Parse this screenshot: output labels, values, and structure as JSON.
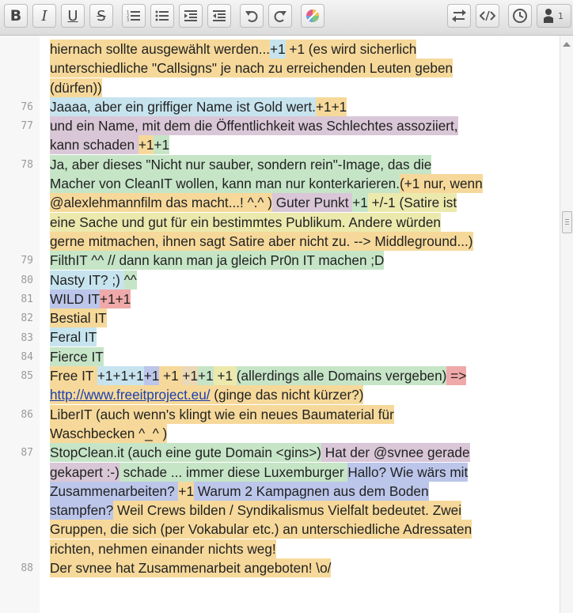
{
  "toolbar": {
    "bold": "B",
    "italic": "I",
    "underline": "U",
    "strike": "S",
    "user_count": "1"
  },
  "lines": [
    {
      "num": "",
      "segs": [
        {
          "t": "hiernach sollte ausgewählt werden...",
          "c": "a1"
        },
        {
          "t": "+1",
          "c": "a2"
        },
        {
          "t": " +1 (es wird sicherlich",
          "c": "a1"
        }
      ]
    },
    {
      "num": "",
      "segs": [
        {
          "t": "unterschiedliche \"Callsigns\" je nach zu erreichenden Leuten geben",
          "c": "a1"
        }
      ]
    },
    {
      "num": "",
      "segs": [
        {
          "t": "(dürfen))",
          "c": "a1"
        }
      ]
    },
    {
      "num": "76",
      "segs": [
        {
          "t": "Jaaaa, aber ein griffiger Name ist Gold wert.",
          "c": "a2"
        },
        {
          "t": "+1+1",
          "c": "a1"
        }
      ]
    },
    {
      "num": "77",
      "segs": [
        {
          "t": "und ein Name, mit dem die Öffentlichkeit was Schlechtes assoziiert,",
          "c": "a3"
        }
      ]
    },
    {
      "num": "",
      "segs": [
        {
          "t": "kann schaden ",
          "c": "a3"
        },
        {
          "t": "+1",
          "c": "a1"
        },
        {
          "t": "+1",
          "c": "a4"
        }
      ]
    },
    {
      "num": "78",
      "segs": [
        {
          "t": "Ja, aber dieses \"Nicht nur sauber, sondern rein\"-Image, das die",
          "c": "a4"
        }
      ]
    },
    {
      "num": "",
      "segs": [
        {
          "t": "Macher von CleanIT wollen, kann man nur konterkarieren.",
          "c": "a4"
        },
        {
          "t": "(+1 nur, wenn",
          "c": "a1"
        }
      ]
    },
    {
      "num": "",
      "segs": [
        {
          "t": "@alexlehmannfilm das macht...! ^.^ )",
          "c": "a1"
        },
        {
          "t": "  Guter Punkt ",
          "c": "a3"
        },
        {
          "t": "+1",
          "c": "a4"
        },
        {
          "t": " +/-1 (Satire ist",
          "c": "a8"
        }
      ]
    },
    {
      "num": "",
      "segs": [
        {
          "t": "eine Sache und gut für ein bestimmtes Publikum. Andere würden",
          "c": "a8"
        }
      ]
    },
    {
      "num": "",
      "segs": [
        {
          "t": "gerne mitmachen, ihnen sagt Satire aber nicht zu. --> Middleground...)",
          "c": "a1"
        }
      ]
    },
    {
      "num": "79",
      "segs": [
        {
          "t": "FilthIT ^^ // dann kann man ja gleich Pr0n IT machen ;D",
          "c": "a4"
        }
      ]
    },
    {
      "num": "80",
      "segs": [
        {
          "t": "Nasty IT? ;) ",
          "c": "a2"
        },
        {
          "t": "^^",
          "c": "a4"
        }
      ]
    },
    {
      "num": "81",
      "segs": [
        {
          "t": "WILD IT",
          "c": "a5"
        },
        {
          "t": "+1+1",
          "c": "a6"
        }
      ]
    },
    {
      "num": "82",
      "segs": [
        {
          "t": "Bestial IT",
          "c": "a1"
        }
      ]
    },
    {
      "num": "83",
      "segs": [
        {
          "t": "Feral IT",
          "c": "a2"
        }
      ]
    },
    {
      "num": "84",
      "segs": [
        {
          "t": "Fierce IT",
          "c": "a4"
        }
      ]
    },
    {
      "num": "85",
      "segs": [
        {
          "t": "Free IT ",
          "c": "a1"
        },
        {
          "t": "+1+1+1",
          "c": "a2"
        },
        {
          "t": "+1",
          "c": "a5"
        },
        {
          "t": " +1 ",
          "c": "a1"
        },
        {
          "t": "+1",
          "c": "a7"
        },
        {
          "t": "+1",
          "c": "a4"
        },
        {
          "t": " +1 ",
          "c": "a8"
        },
        {
          "t": "(allerdings alle Domains vergeben)",
          "c": "a4"
        },
        {
          "t": " =>",
          "c": "a6"
        }
      ]
    },
    {
      "num": "",
      "segs": [
        {
          "t": "http://www.freeitproject.eu/",
          "c": "a1",
          "link": true
        },
        {
          "t": " (ginge das nicht kürzer?)",
          "c": "a1"
        }
      ]
    },
    {
      "num": "86",
      "segs": [
        {
          "t": "LiberIT (auch wenn's klingt wie ein neues Baumaterial für",
          "c": "a1"
        }
      ]
    },
    {
      "num": "",
      "segs": [
        {
          "t": "Waschbecken ^_^ )",
          "c": "a1"
        }
      ]
    },
    {
      "num": "87",
      "segs": [
        {
          "t": "StopClean.it  (auch eine gute Domain <gins>)",
          "c": "a4"
        },
        {
          "t": " Hat der @svnee gerade",
          "c": "a3"
        }
      ]
    },
    {
      "num": "",
      "segs": [
        {
          "t": "gekapert :-)",
          "c": "a3"
        },
        {
          "t": "  schade ... immer diese Luxemburger ",
          "c": "a4"
        },
        {
          "t": "Hallo? Wie wärs mit",
          "c": "a5"
        }
      ]
    },
    {
      "num": "",
      "segs": [
        {
          "t": "Zusammenarbeiten? ",
          "c": "a5"
        },
        {
          "t": "+1",
          "c": "a1"
        },
        {
          "t": " Warum 2 Kampagnen aus dem Boden",
          "c": "a5"
        }
      ]
    },
    {
      "num": "",
      "segs": [
        {
          "t": "stampfen?",
          "c": "a5"
        },
        {
          "t": " Weil Crews bilden / Syndikalismus Vielfalt bedeutet. Zwei",
          "c": "a1"
        }
      ]
    },
    {
      "num": "",
      "segs": [
        {
          "t": "Gruppen, die sich (per Vokabular etc.) an unterschiedliche Adressaten",
          "c": "a1"
        }
      ]
    },
    {
      "num": "",
      "segs": [
        {
          "t": "richten, nehmen einander nichts weg!",
          "c": "a1"
        }
      ]
    },
    {
      "num": "88",
      "segs": [
        {
          "t": "Der svnee hat Zusammenarbeit angeboten! \\o/",
          "c": "a1"
        }
      ]
    }
  ]
}
